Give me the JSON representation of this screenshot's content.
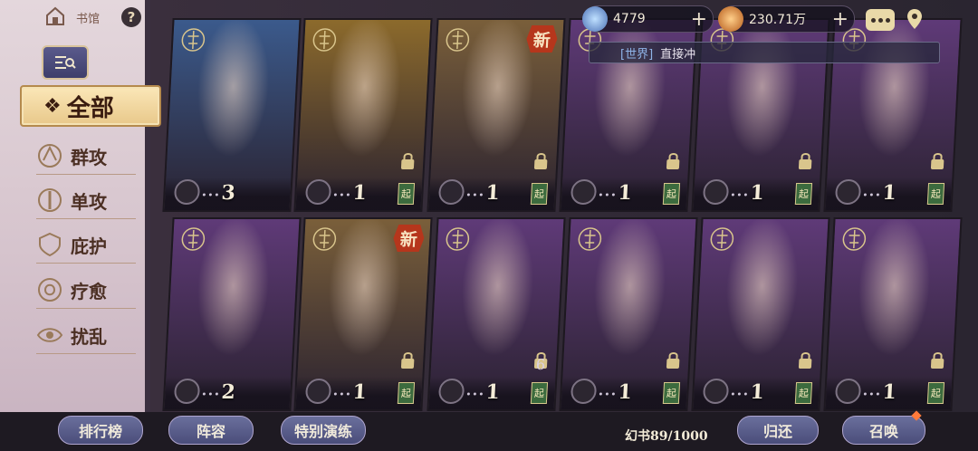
{
  "left_panel": {
    "home_label": "书馆",
    "help_icon": "?",
    "all_tab": "全部",
    "categories": [
      "群攻",
      "单攻",
      "庇护",
      "疗愈",
      "扰乱"
    ]
  },
  "hud": {
    "gems": "4779",
    "coins": "230.71万",
    "world_tag": "[世界]",
    "world_message": "直接冲"
  },
  "cards": [
    {
      "level": "3",
      "new": "",
      "seal": "",
      "row": 0,
      "col": 0,
      "color": "#3b5a8c"
    },
    {
      "level": "1",
      "new": "",
      "seal": "起",
      "row": 0,
      "col": 1,
      "color": "#8c6a2c"
    },
    {
      "level": "1",
      "new": "新",
      "seal": "起",
      "row": 0,
      "col": 2,
      "color": "#7a5f3a"
    },
    {
      "level": "1",
      "new": "",
      "seal": "起",
      "row": 0,
      "col": 3,
      "color": "#5f3a78"
    },
    {
      "level": "1",
      "new": "",
      "seal": "起",
      "row": 0,
      "col": 4,
      "color": "#5f3a78"
    },
    {
      "level": "1",
      "new": "",
      "seal": "起",
      "row": 0,
      "col": 5,
      "color": "#5f3a78"
    },
    {
      "level": "2",
      "new": "",
      "seal": "",
      "row": 1,
      "col": 0,
      "color": "#5f3a78"
    },
    {
      "level": "1",
      "new": "新",
      "seal": "起",
      "row": 1,
      "col": 1,
      "color": "#7a5f3a"
    },
    {
      "level": "1",
      "new": "",
      "seal": "起",
      "row": 1,
      "col": 2,
      "color": "#5f3a78"
    },
    {
      "level": "1",
      "new": "",
      "seal": "起",
      "row": 1,
      "col": 3,
      "color": "#5f3a78"
    },
    {
      "level": "1",
      "new": "",
      "seal": "起",
      "row": 1,
      "col": 4,
      "color": "#5f3a78"
    },
    {
      "level": "1",
      "new": "",
      "seal": "起",
      "row": 1,
      "col": 5,
      "color": "#5f3a78"
    }
  ],
  "card_extra": "6",
  "bottom_bar": {
    "ranking": "排行榜",
    "formation": "阵容",
    "special_drill": "特别演练",
    "book_count": "幻书89/1000",
    "return": "归还",
    "summon": "召唤"
  },
  "colors": {
    "accent_gold": "#e8c88a",
    "seal_green": "#3c6b3e",
    "new_red": "#b6361c",
    "button_blue": "#4a4d7a"
  }
}
